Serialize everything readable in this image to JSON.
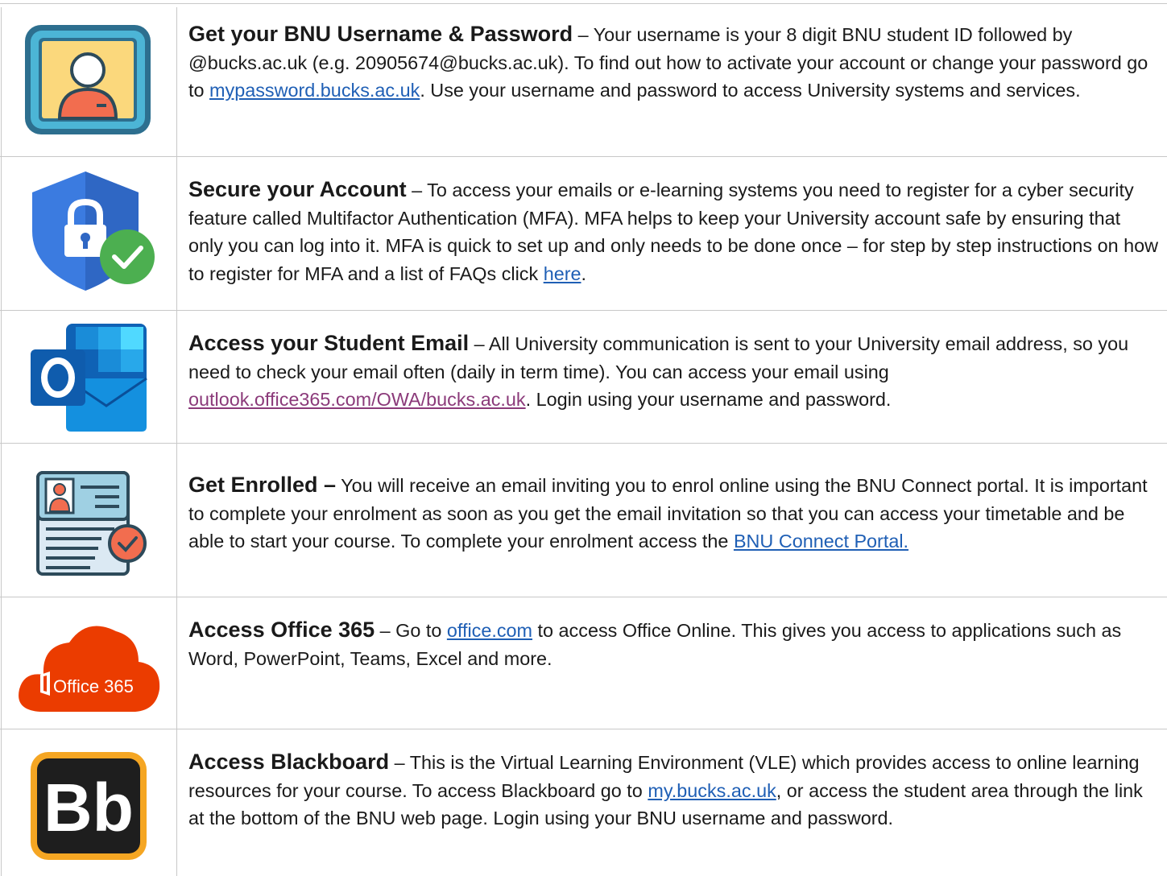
{
  "rows": [
    {
      "title": "Get your BNU Username & Password",
      "seg1": " – Your username is your 8 digit BNU student ID followed by @bucks.ac.uk (e.g. 20905674@bucks.ac.uk). To find out how to activate your account or change your password go to ",
      "link": "mypassword.bucks.ac.uk",
      "seg2": ". Use your username and password to access University systems and services."
    },
    {
      "title": "Secure your Account",
      "seg1": " – To access your emails or e-learning systems you need to register for a cyber security feature called Multifactor Authentication (MFA). MFA helps to keep your University account safe by ensuring that only you can log into it. MFA is quick to set up and only needs to be done once – for step by step instructions on how to register for MFA and a list of FAQs click ",
      "link": "here",
      "seg2": "."
    },
    {
      "title": "Access your Student Email",
      "seg1": " – All University communication is sent to your University email address, so you need to check your email often (daily in term time). You can access your email using ",
      "link": "outlook.office365.com/OWA/bucks.ac.uk",
      "seg2": ". Login using your username and password."
    },
    {
      "title": "Get Enrolled –",
      "seg1": " You will receive an email inviting you to enrol online using the BNU Connect portal. It is important to complete your enrolment as soon as you get the email invitation so that you can access your timetable and be able to start your course. To complete your enrolment access the ",
      "link": "BNU Connect Portal. ",
      "seg2": ""
    },
    {
      "title": "Access Office 365",
      "seg1": " – Go to ",
      "link": "office.com",
      "seg2": " to access Office Online. This gives you access to applications such as Word, PowerPoint, Teams, Excel and more."
    },
    {
      "title": "Access Blackboard",
      "seg1": " – This is the Virtual Learning Environment (VLE) which provides access to online learning resources for your course. To access Blackboard go to ",
      "link": "my.bucks.ac.uk",
      "seg2": ", or access the student area through the link at the bottom of the BNU web page. Login using your BNU username and password."
    }
  ],
  "icons": {
    "office_logo_text": "Office 365",
    "blackboard_logo_text": "Bb"
  },
  "colors": {
    "link": "#1f5fb5",
    "visited_link": "#8b3a7a",
    "office_red": "#eb3c00",
    "blackboard_orange": "#f5a623"
  }
}
